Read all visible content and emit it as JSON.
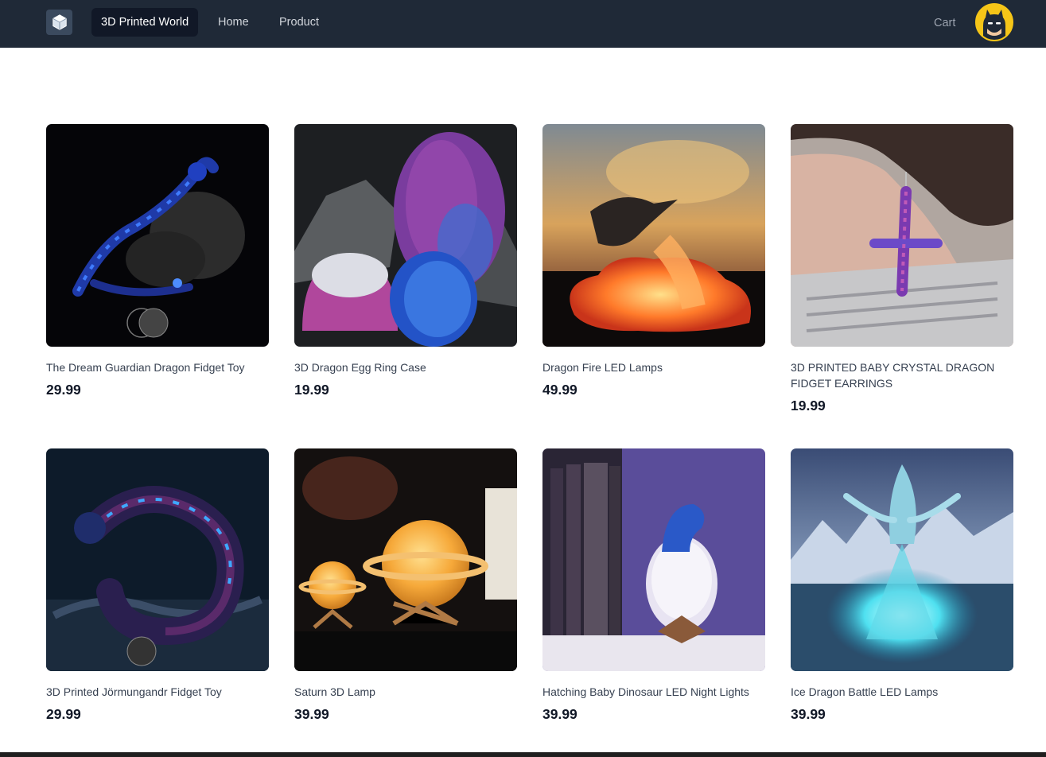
{
  "navbar": {
    "brand": "3D Printed World",
    "links": [
      {
        "label": "Home"
      },
      {
        "label": "Product"
      }
    ],
    "cart_label": "Cart"
  },
  "icons": {
    "logo": "cube-logo-icon",
    "avatar": "batman-avatar"
  },
  "colors": {
    "navbar_bg": "#1f2937",
    "brand_bg": "#111827",
    "text_primary": "#111827",
    "text_secondary": "#374151"
  },
  "products": [
    {
      "name": "The Dream Guardian Dragon Fidget Toy",
      "price": "29.99"
    },
    {
      "name": "3D Dragon Egg Ring Case",
      "price": "19.99"
    },
    {
      "name": "Dragon Fire LED Lamps",
      "price": "49.99"
    },
    {
      "name": "3D PRINTED BABY CRYSTAL DRAGON FIDGET EARRINGS",
      "price": "19.99"
    },
    {
      "name": "3D Printed Jörmungandr Fidget Toy",
      "price": "29.99"
    },
    {
      "name": "Saturn 3D Lamp",
      "price": "39.99"
    },
    {
      "name": "Hatching Baby Dinosaur LED Night Lights",
      "price": "39.99"
    },
    {
      "name": "Ice Dragon Battle LED Lamps",
      "price": "39.99"
    }
  ]
}
